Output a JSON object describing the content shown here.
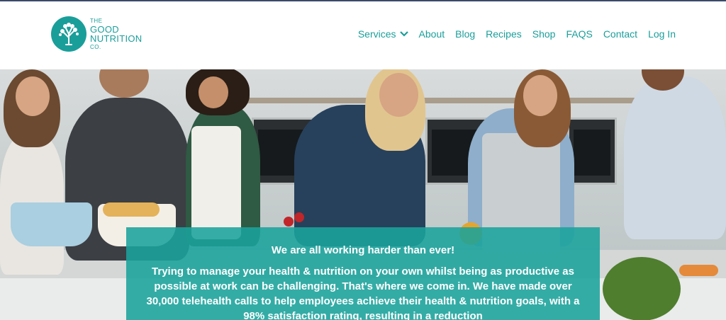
{
  "logo": {
    "line1": "THE",
    "line2": "GOOD",
    "line3": "NUTRITION",
    "line4": "CO.",
    "icon": "tree-icon"
  },
  "nav": {
    "items": [
      {
        "label": "Services",
        "has_dropdown": true
      },
      {
        "label": "About"
      },
      {
        "label": "Blog"
      },
      {
        "label": "Recipes"
      },
      {
        "label": "Shop"
      },
      {
        "label": "FAQS"
      },
      {
        "label": "Contact"
      },
      {
        "label": "Log In"
      }
    ]
  },
  "hero": {
    "heading": "We are all working harder than ever!",
    "body": "Trying to manage your health & nutrition on your own whilst being as productive as possible at work can be challenging. That's where we come in. We have made over 30,000 telehealth calls to help employees achieve their health & nutrition goals, with a 98% satisfaction rating, resulting in a reduction"
  },
  "colors": {
    "brand": "#1a9e9a",
    "overlay": "#1aa39c",
    "top_border": "#3a4a6b"
  }
}
